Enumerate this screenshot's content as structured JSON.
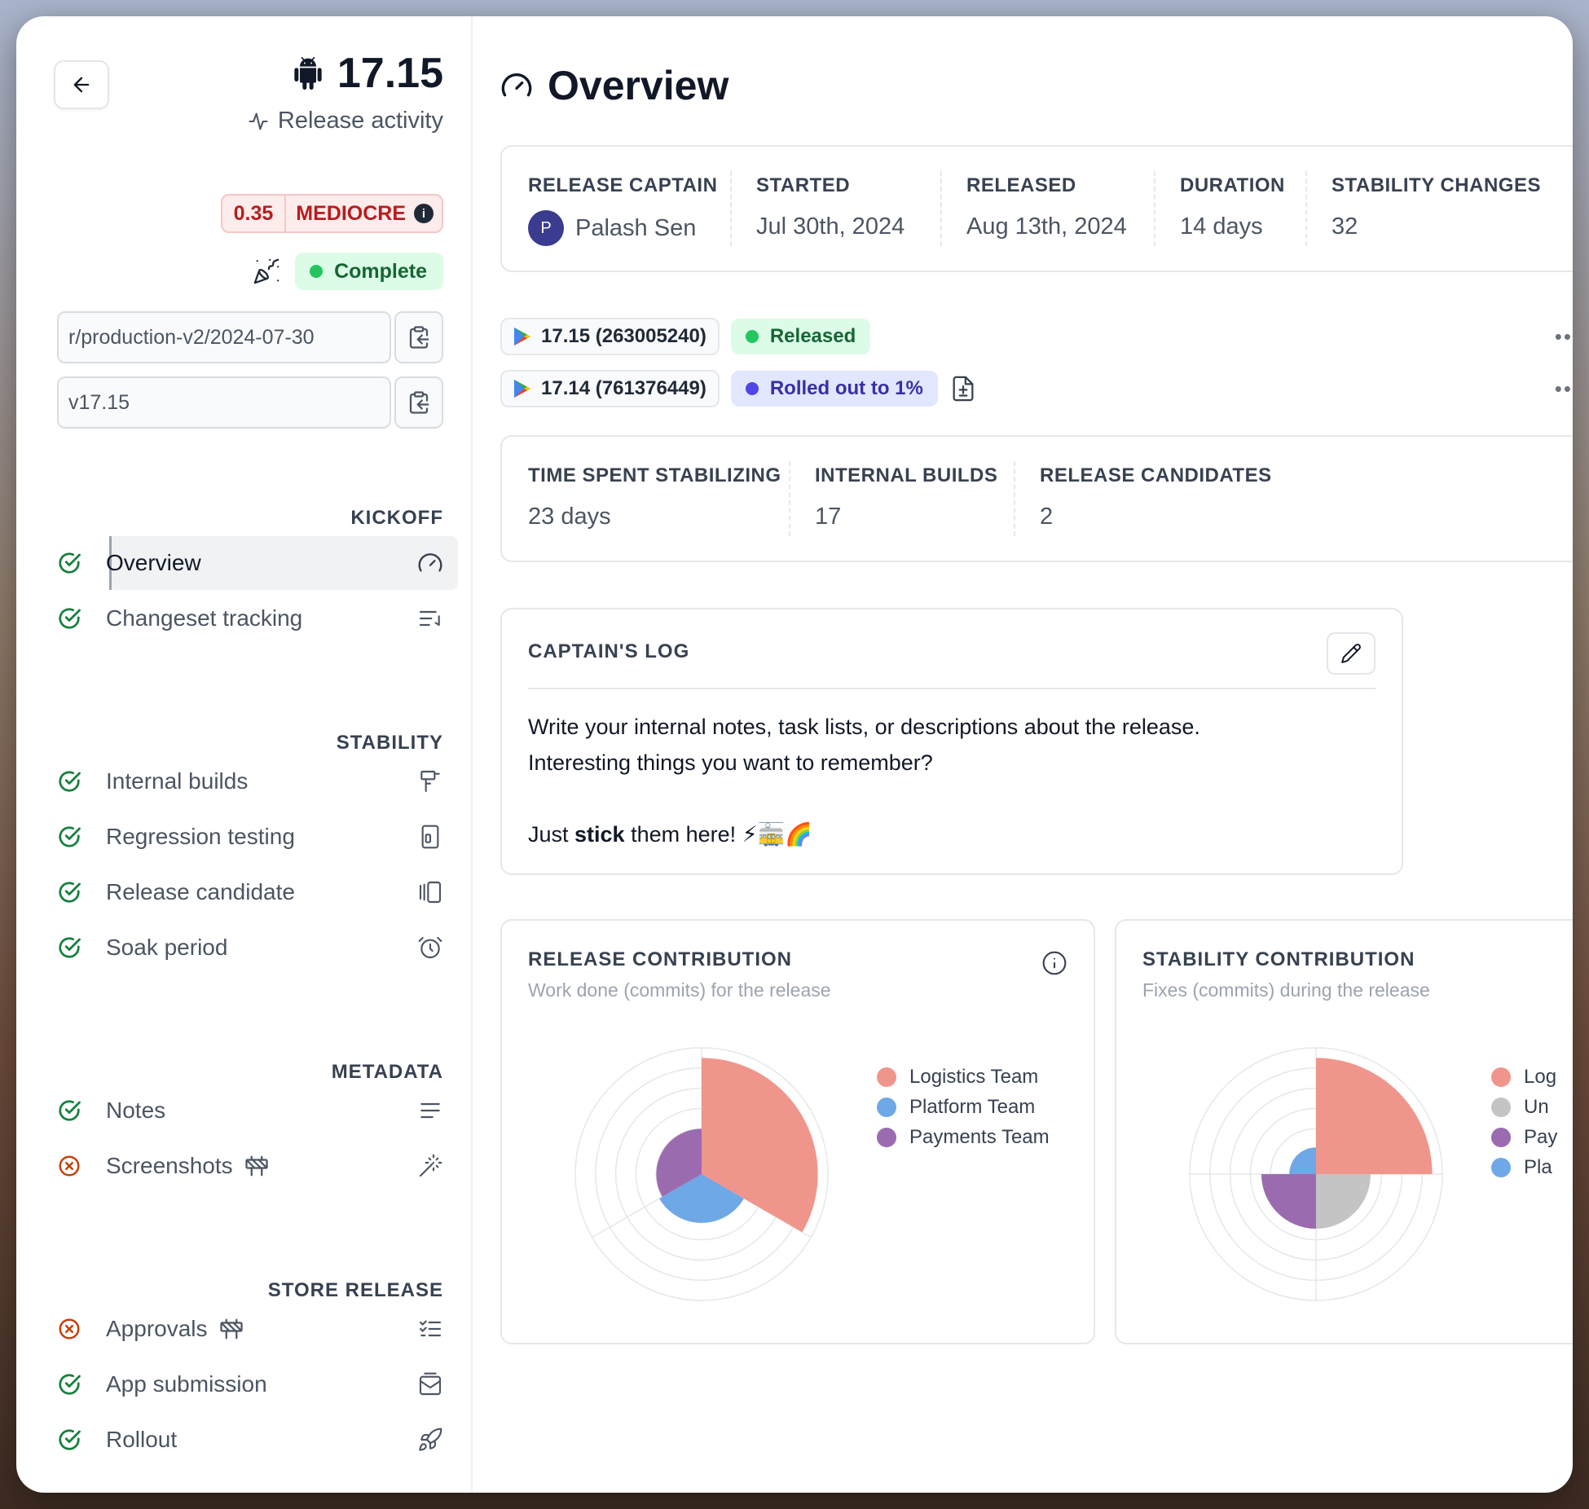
{
  "header": {
    "version": "17.15",
    "activity_label": "Release activity",
    "score": "0.35",
    "score_label": "MEDIOCRE",
    "status_label": "Complete"
  },
  "fields": {
    "branch": "r/production-v2/2024-07-30",
    "tag": "v17.15"
  },
  "sidebar": {
    "sections": [
      {
        "title": "KICKOFF",
        "items": [
          {
            "label": "Overview",
            "status": "done",
            "icon": "gauge-icon"
          },
          {
            "label": "Changeset tracking",
            "status": "done",
            "icon": "list-check-icon"
          }
        ]
      },
      {
        "title": "STABILITY",
        "items": [
          {
            "label": "Internal builds",
            "status": "done",
            "icon": "hammer-icon"
          },
          {
            "label": "Regression testing",
            "status": "done",
            "icon": "device-icon"
          },
          {
            "label": "Release candidate",
            "status": "done",
            "icon": "carousel-icon"
          },
          {
            "label": "Soak period",
            "status": "done",
            "icon": "alarm-icon"
          }
        ]
      },
      {
        "title": "METADATA",
        "items": [
          {
            "label": "Notes",
            "status": "done",
            "icon": "text-lines-icon"
          },
          {
            "label": "Screenshots",
            "status": "blocked",
            "icon": "magic-wand-icon"
          }
        ]
      },
      {
        "title": "STORE RELEASE",
        "items": [
          {
            "label": "Approvals",
            "status": "blocked",
            "icon": "checklist-icon"
          },
          {
            "label": "App submission",
            "status": "done",
            "icon": "inbox-icon"
          },
          {
            "label": "Rollout",
            "status": "done",
            "icon": "rocket-icon"
          }
        ]
      }
    ]
  },
  "main": {
    "title": "Overview",
    "stats": {
      "captain_label": "RELEASE CAPTAIN",
      "captain_initial": "P",
      "captain_name": "Palash Sen",
      "started_label": "STARTED",
      "started_value": "Jul 30th, 2024",
      "released_label": "RELEASED",
      "released_value": "Aug 13th, 2024",
      "duration_label": "DURATION",
      "duration_value": "14 days",
      "stability_label": "STABILITY CHANGES",
      "stability_value": "32"
    },
    "builds": [
      {
        "name": "17.15 (263005240)",
        "status": "Released",
        "status_color": "#22c55e"
      },
      {
        "name": "17.14 (761376449)",
        "status": "Rolled out to 1%",
        "status_color": "#4f46e5"
      }
    ],
    "stabilizing": {
      "time_label": "TIME SPENT STABILIZING",
      "time_value": "23 days",
      "builds_label": "INTERNAL BUILDS",
      "builds_value": "17",
      "candidates_label": "RELEASE CANDIDATES",
      "candidates_value": "2"
    },
    "captains_log": {
      "title": "CAPTAIN'S LOG",
      "line1": "Write your internal notes, task lists, or descriptions about the release.",
      "line2": "Interesting things you want to remember?",
      "line3_prefix": "Just ",
      "line3_bold": "stick",
      "line3_suffix": " them here! ⚡🚋🌈"
    }
  },
  "chart_data": [
    {
      "type": "polar-area",
      "title": "RELEASE CONTRIBUTION",
      "subtitle": "Work done (commits) for the release",
      "series": [
        {
          "name": "Logistics Team",
          "color": "#f0958b",
          "value": 100
        },
        {
          "name": "Platform Team",
          "color": "#6fa8e6",
          "value": 42
        },
        {
          "name": "Payments Team",
          "color": "#9b6bb0",
          "value": 39
        }
      ]
    },
    {
      "type": "polar-area",
      "title": "STABILITY CONTRIBUTION",
      "subtitle": "Fixes (commits) during the release",
      "series": [
        {
          "name": "Log",
          "color": "#f0958b",
          "value": 100
        },
        {
          "name": "Un",
          "color": "#c4c4c4",
          "value": 47
        },
        {
          "name": "Pay",
          "color": "#9b6bb0",
          "value": 47
        },
        {
          "name": "Pla",
          "color": "#6fa8e6",
          "value": 23
        }
      ]
    }
  ]
}
